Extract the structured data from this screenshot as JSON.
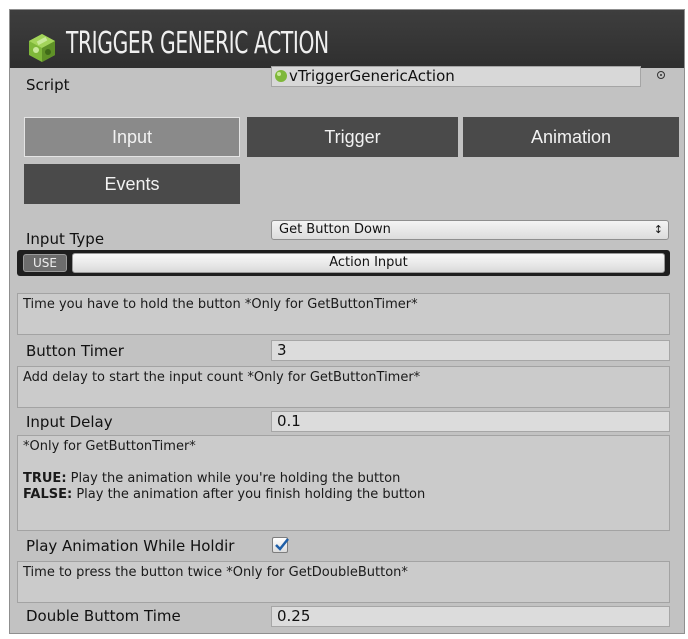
{
  "header": {
    "title": "TRIGGER GENERIC ACTION"
  },
  "script": {
    "label": "Script",
    "value": "vTriggerGenericAction"
  },
  "tabs": [
    {
      "label": "Input",
      "active": true
    },
    {
      "label": "Trigger",
      "active": false
    },
    {
      "label": "Animation",
      "active": false
    },
    {
      "label": "Events",
      "active": false
    }
  ],
  "input_type": {
    "label": "Input Type",
    "value": "Get Button Down",
    "arrows": "↕"
  },
  "action_input": {
    "badge": "USE",
    "label": "Action Input"
  },
  "help": {
    "hold_time": "Time you have to hold the button *Only for GetButtonTimer*",
    "input_delay": "Add delay to start the input count *Only for GetButtonTimer*",
    "play_anim_title": "*Only for GetButtonTimer*",
    "true_label": "TRUE:",
    "true_text": " Play the animation while you're holding the button",
    "false_label": "FALSE:",
    "false_text": " Play the animation after you finish holding the button",
    "double_press": "Time to press the button twice *Only for GetDoubleButton*"
  },
  "fields": {
    "button_timer": {
      "label": "Button Timer",
      "value": "3"
    },
    "input_delay": {
      "label": "Input Delay",
      "value": "0.1"
    },
    "play_anim": {
      "label": "Play Animation While Holdir",
      "checked": true
    },
    "double_time": {
      "label": "Double Buttom Time",
      "value": "0.25"
    }
  },
  "colors": {
    "header_bg": "#353535",
    "panel_bg": "#c2c2c2",
    "tab_bg": "#4a4a4a",
    "tab_active_bg": "#8a8a8a",
    "logo_green": "#8dc63f"
  }
}
